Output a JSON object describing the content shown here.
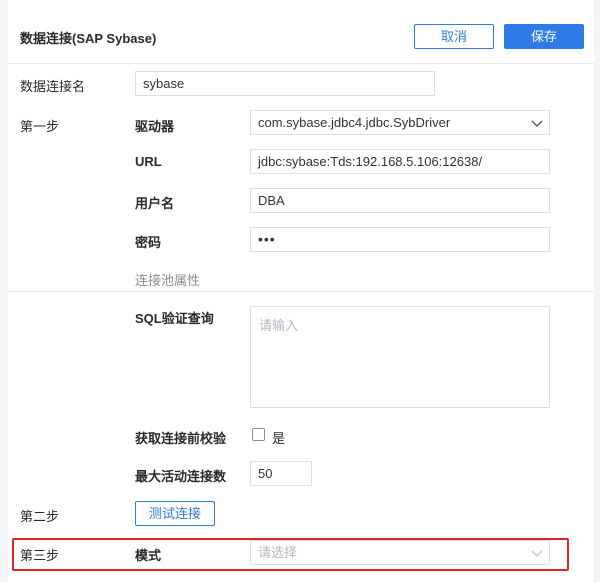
{
  "header": {
    "title": "数据连接(SAP Sybase)",
    "cancel_label": "取消",
    "save_label": "保存"
  },
  "connection_name": {
    "label": "数据连接名",
    "value": "sybase"
  },
  "step1": {
    "label": "第一步",
    "driver": {
      "label": "驱动器",
      "value": "com.sybase.jdbc4.jdbc.SybDriver"
    },
    "url": {
      "label": "URL",
      "value": "jdbc:sybase:Tds:192.168.5.106:12638/"
    },
    "username": {
      "label": "用户名",
      "value": "DBA"
    },
    "password": {
      "label": "密码",
      "value": "•••"
    }
  },
  "pool": {
    "section_title": "连接池属性",
    "sql_validation": {
      "label": "SQL验证查询",
      "placeholder": "请输入"
    },
    "validate_before": {
      "label": "获取连接前校验",
      "option_label": "是",
      "checked": false
    },
    "max_active": {
      "label": "最大活动连接数",
      "value": "50"
    }
  },
  "step2": {
    "label": "第二步",
    "test_button": "测试连接"
  },
  "step3": {
    "label": "第三步",
    "mode": {
      "label": "模式",
      "placeholder": "请选择"
    }
  },
  "colors": {
    "accent": "#2e7be8",
    "highlight": "#e0242a"
  }
}
